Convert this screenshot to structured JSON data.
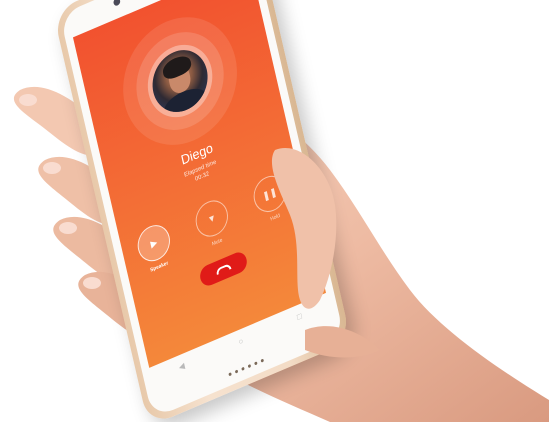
{
  "call": {
    "caller_name": "Diego",
    "elapsed_label": "Elapsed time",
    "elapsed_time": "00:32"
  },
  "controls": [
    {
      "label": "Speaker",
      "icon": "speaker-icon",
      "active": true
    },
    {
      "label": "Mute",
      "icon": "mic-icon",
      "active": false
    },
    {
      "label": "Hold",
      "icon": "pause-icon",
      "active": false
    }
  ],
  "end_call": {
    "icon": "phone-hangup-icon"
  },
  "colors": {
    "screen_top": "#f2522f",
    "screen_bottom": "#f4883a",
    "end_call": "#e01b18",
    "phone_body": "#f3dcc6"
  }
}
